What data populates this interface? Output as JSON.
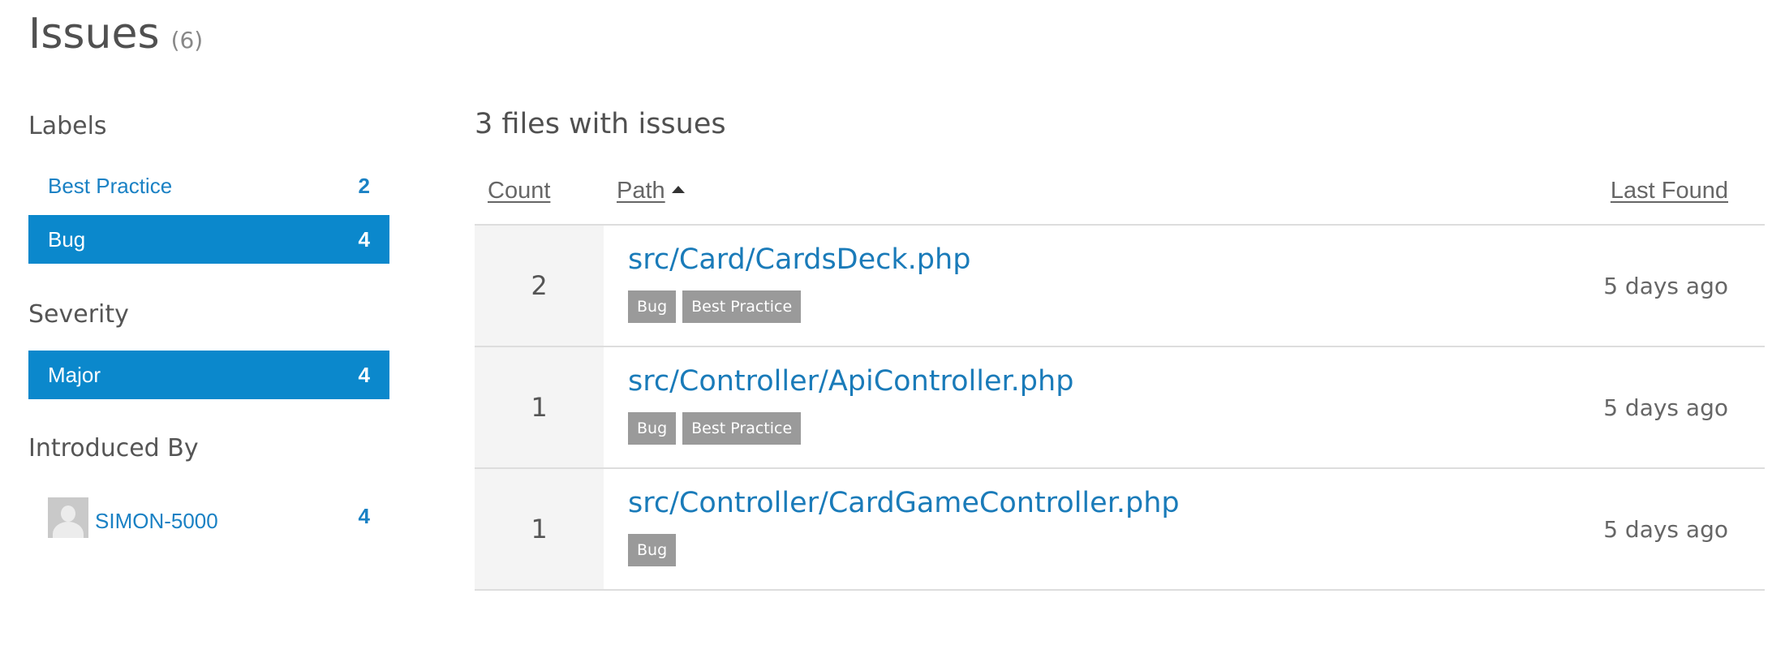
{
  "header": {
    "title": "Issues",
    "count": "(6)"
  },
  "sidebar": {
    "labels": {
      "heading": "Labels",
      "items": [
        {
          "label": "Best Practice",
          "count": "2",
          "active": false
        },
        {
          "label": "Bug",
          "count": "4",
          "active": true
        }
      ]
    },
    "severity": {
      "heading": "Severity",
      "items": [
        {
          "label": "Major",
          "count": "4",
          "active": true
        }
      ]
    },
    "introduced_by": {
      "heading": "Introduced By",
      "items": [
        {
          "label": "SIMON-5000",
          "count": "4",
          "avatar": "user-avatar-placeholder"
        }
      ]
    }
  },
  "main": {
    "heading": "3 files with issues",
    "columns": {
      "count": "Count",
      "path": "Path",
      "last_found": "Last Found"
    },
    "sort": {
      "column": "path",
      "direction": "ascending"
    },
    "rows": [
      {
        "count": "2",
        "path": "src/Card/CardsDeck.php",
        "tags": [
          "Bug",
          "Best Practice"
        ],
        "last_found": "5 days ago"
      },
      {
        "count": "1",
        "path": "src/Controller/ApiController.php",
        "tags": [
          "Bug",
          "Best Practice"
        ],
        "last_found": "5 days ago"
      },
      {
        "count": "1",
        "path": "src/Controller/CardGameController.php",
        "tags": [
          "Bug"
        ],
        "last_found": "5 days ago"
      }
    ]
  },
  "colors": {
    "accent": "#0b88cc",
    "link": "#1a7bb9",
    "tag_bg": "#9a9a9a",
    "count_cell_bg": "#f4f4f4"
  }
}
